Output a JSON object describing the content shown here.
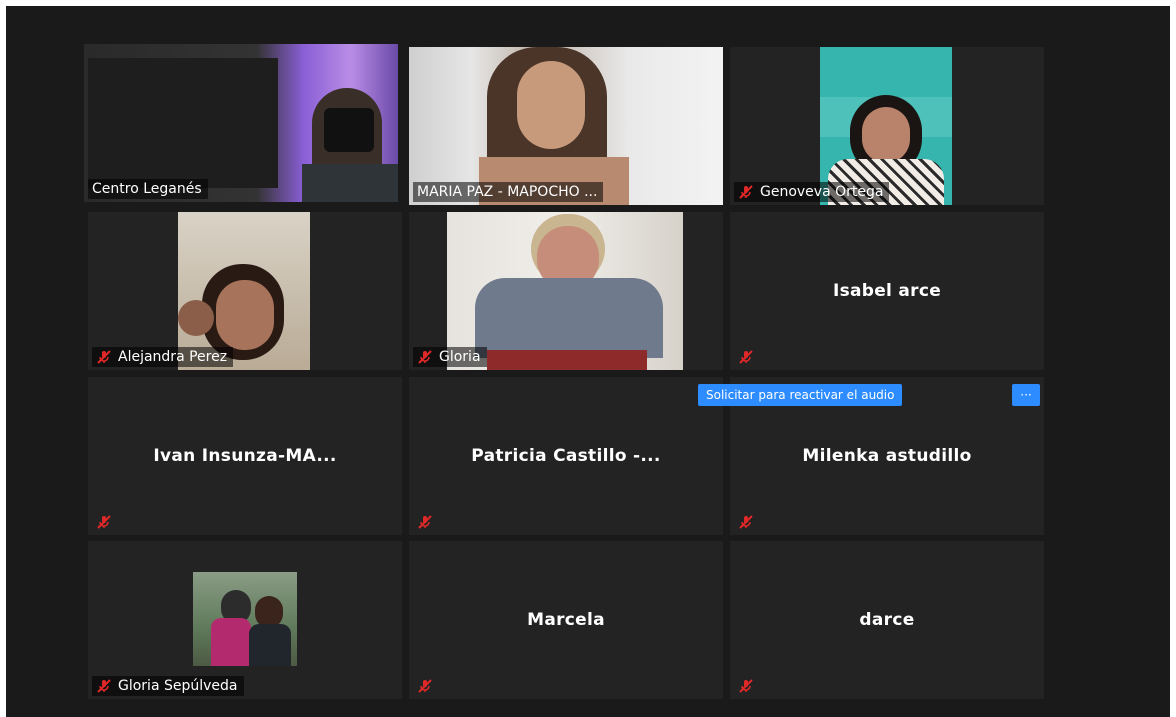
{
  "participants": [
    {
      "name": "Centro Leganés",
      "label": "Centro Leganés",
      "muted": false,
      "has_video": true
    },
    {
      "name": "MARIA PAZ - MAPOCHO ...",
      "label": "MARIA PAZ - MAPOCHO ...",
      "muted": false,
      "has_video": true
    },
    {
      "name": "Genoveva Ortega",
      "label": "Genoveva Ortega",
      "muted": true,
      "has_video": true
    },
    {
      "name": "Alejandra Perez",
      "label": "Alejandra Perez",
      "muted": true,
      "has_video": true
    },
    {
      "name": "Gloria",
      "label": "Gloria",
      "muted": true,
      "has_video": true
    },
    {
      "name": "Isabel arce",
      "label": "",
      "muted": true,
      "has_video": false
    },
    {
      "name": "Ivan  Insunza-MA...",
      "label": "",
      "muted": true,
      "has_video": false
    },
    {
      "name": "Patricia Castillo -...",
      "label": "",
      "muted": true,
      "has_video": false
    },
    {
      "name": "Milenka astudillo",
      "label": "",
      "muted": true,
      "has_video": false
    },
    {
      "name": "Gloria Sepúlveda",
      "label": "Gloria Sepúlveda",
      "muted": true,
      "has_video": true
    },
    {
      "name": "Marcela",
      "label": "",
      "muted": true,
      "has_video": false
    },
    {
      "name": "darce",
      "label": "",
      "muted": true,
      "has_video": false
    }
  ],
  "unmute_request": {
    "label": "Solicitar para reactivar el audio",
    "more_label": "···"
  },
  "colors": {
    "active_speaker": "#d6e26a",
    "muted_icon": "#e02828",
    "button": "#2d8cff",
    "tile": "#232323"
  },
  "icons": {
    "mic_muted": "mic-muted-icon",
    "more": "more-options-icon"
  }
}
